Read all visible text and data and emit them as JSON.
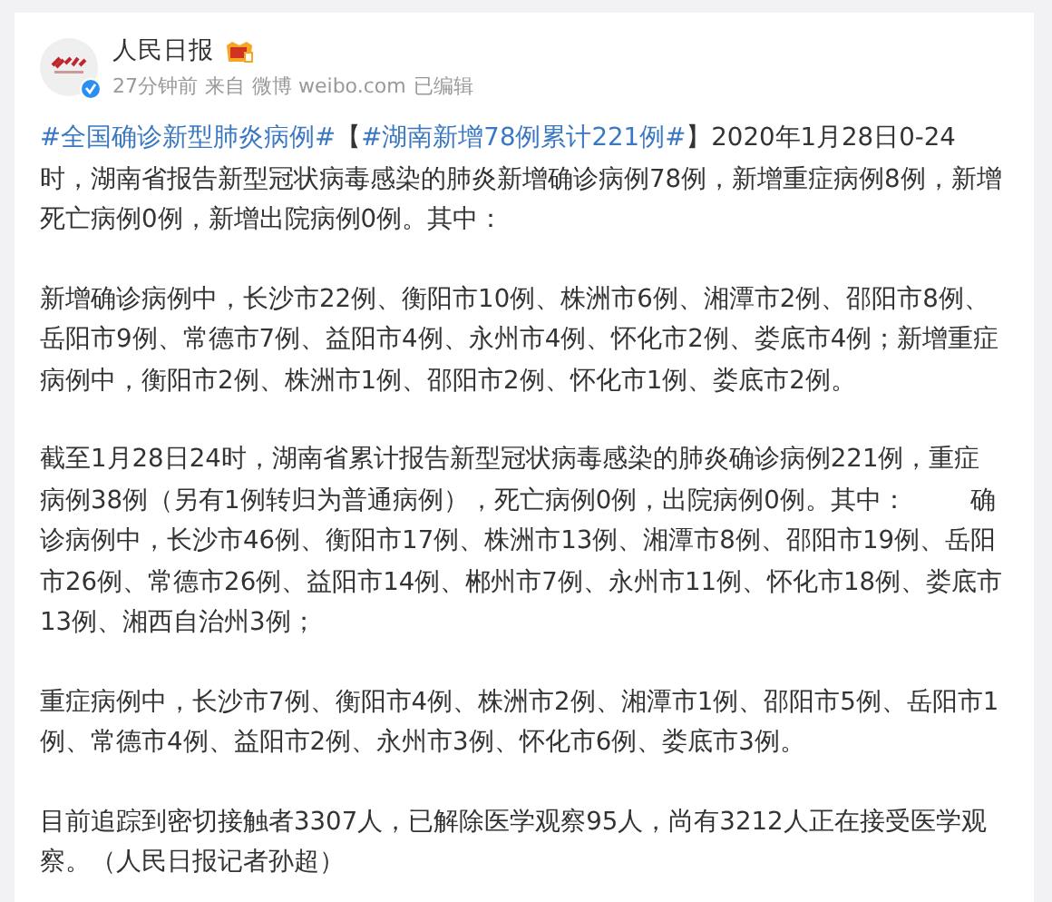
{
  "post": {
    "author": "人民日报",
    "meta": [
      "27分钟前",
      "来自",
      "微博 weibo.com",
      "已编辑"
    ],
    "paragraphs": [
      {
        "parts": [
          {
            "kind": "topic",
            "text": "#全国确诊新型肺炎病例#"
          },
          {
            "kind": "text",
            "text": "【"
          },
          {
            "kind": "topic",
            "text": "#湖南新增78例累计221例#"
          },
          {
            "kind": "text",
            "text": "】2020年1月28日0-24时，湖南省报告新型冠状病毒感染的肺炎新增确诊病例78例，新增重症病例8例，新增死亡病例0例，新增出院病例0例。其中："
          }
        ]
      },
      {
        "parts": [
          {
            "kind": "text",
            "text": "新增确诊病例中，长沙市22例、衡阳市10例、株洲市6例、湘潭市2例、邵阳市8例、岳阳市9例、常德市7例、益阳市4例、永州市4例、怀化市2例、娄底市4例；新增重症病例中，衡阳市2例、株洲市1例、邵阳市2例、怀化市1例、娄底市2例。"
          }
        ]
      },
      {
        "parts": [
          {
            "kind": "text",
            "text": "截至1月28日24时，湖南省累计报告新型冠状病毒感染的肺炎确诊病例221例，重症病例38例（另有1例转归为普通病例），死亡病例0例，出院病例0例。其中：        确诊病例中，长沙市46例、衡阳市17例、株洲市13例、湘潭市8例、邵阳市19例、岳阳市26例、常德市26例、益阳市14例、郴州市7例、永州市11例、怀化市18例、娄底市13例、湘西自治州3例；"
          }
        ]
      },
      {
        "parts": [
          {
            "kind": "text",
            "text": "重症病例中，长沙市7例、衡阳市4例、株洲市2例、湘潭市1例、邵阳市5例、岳阳市1例、常德市4例、益阳市2例、永州市3例、怀化市6例、娄底市3例。"
          }
        ]
      },
      {
        "parts": [
          {
            "kind": "text",
            "text": "目前追踪到密切接触者3307人，已解除医学观察95人，尚有3212人正在接受医学观察。（人民日报记者孙超）"
          }
        ]
      }
    ]
  }
}
